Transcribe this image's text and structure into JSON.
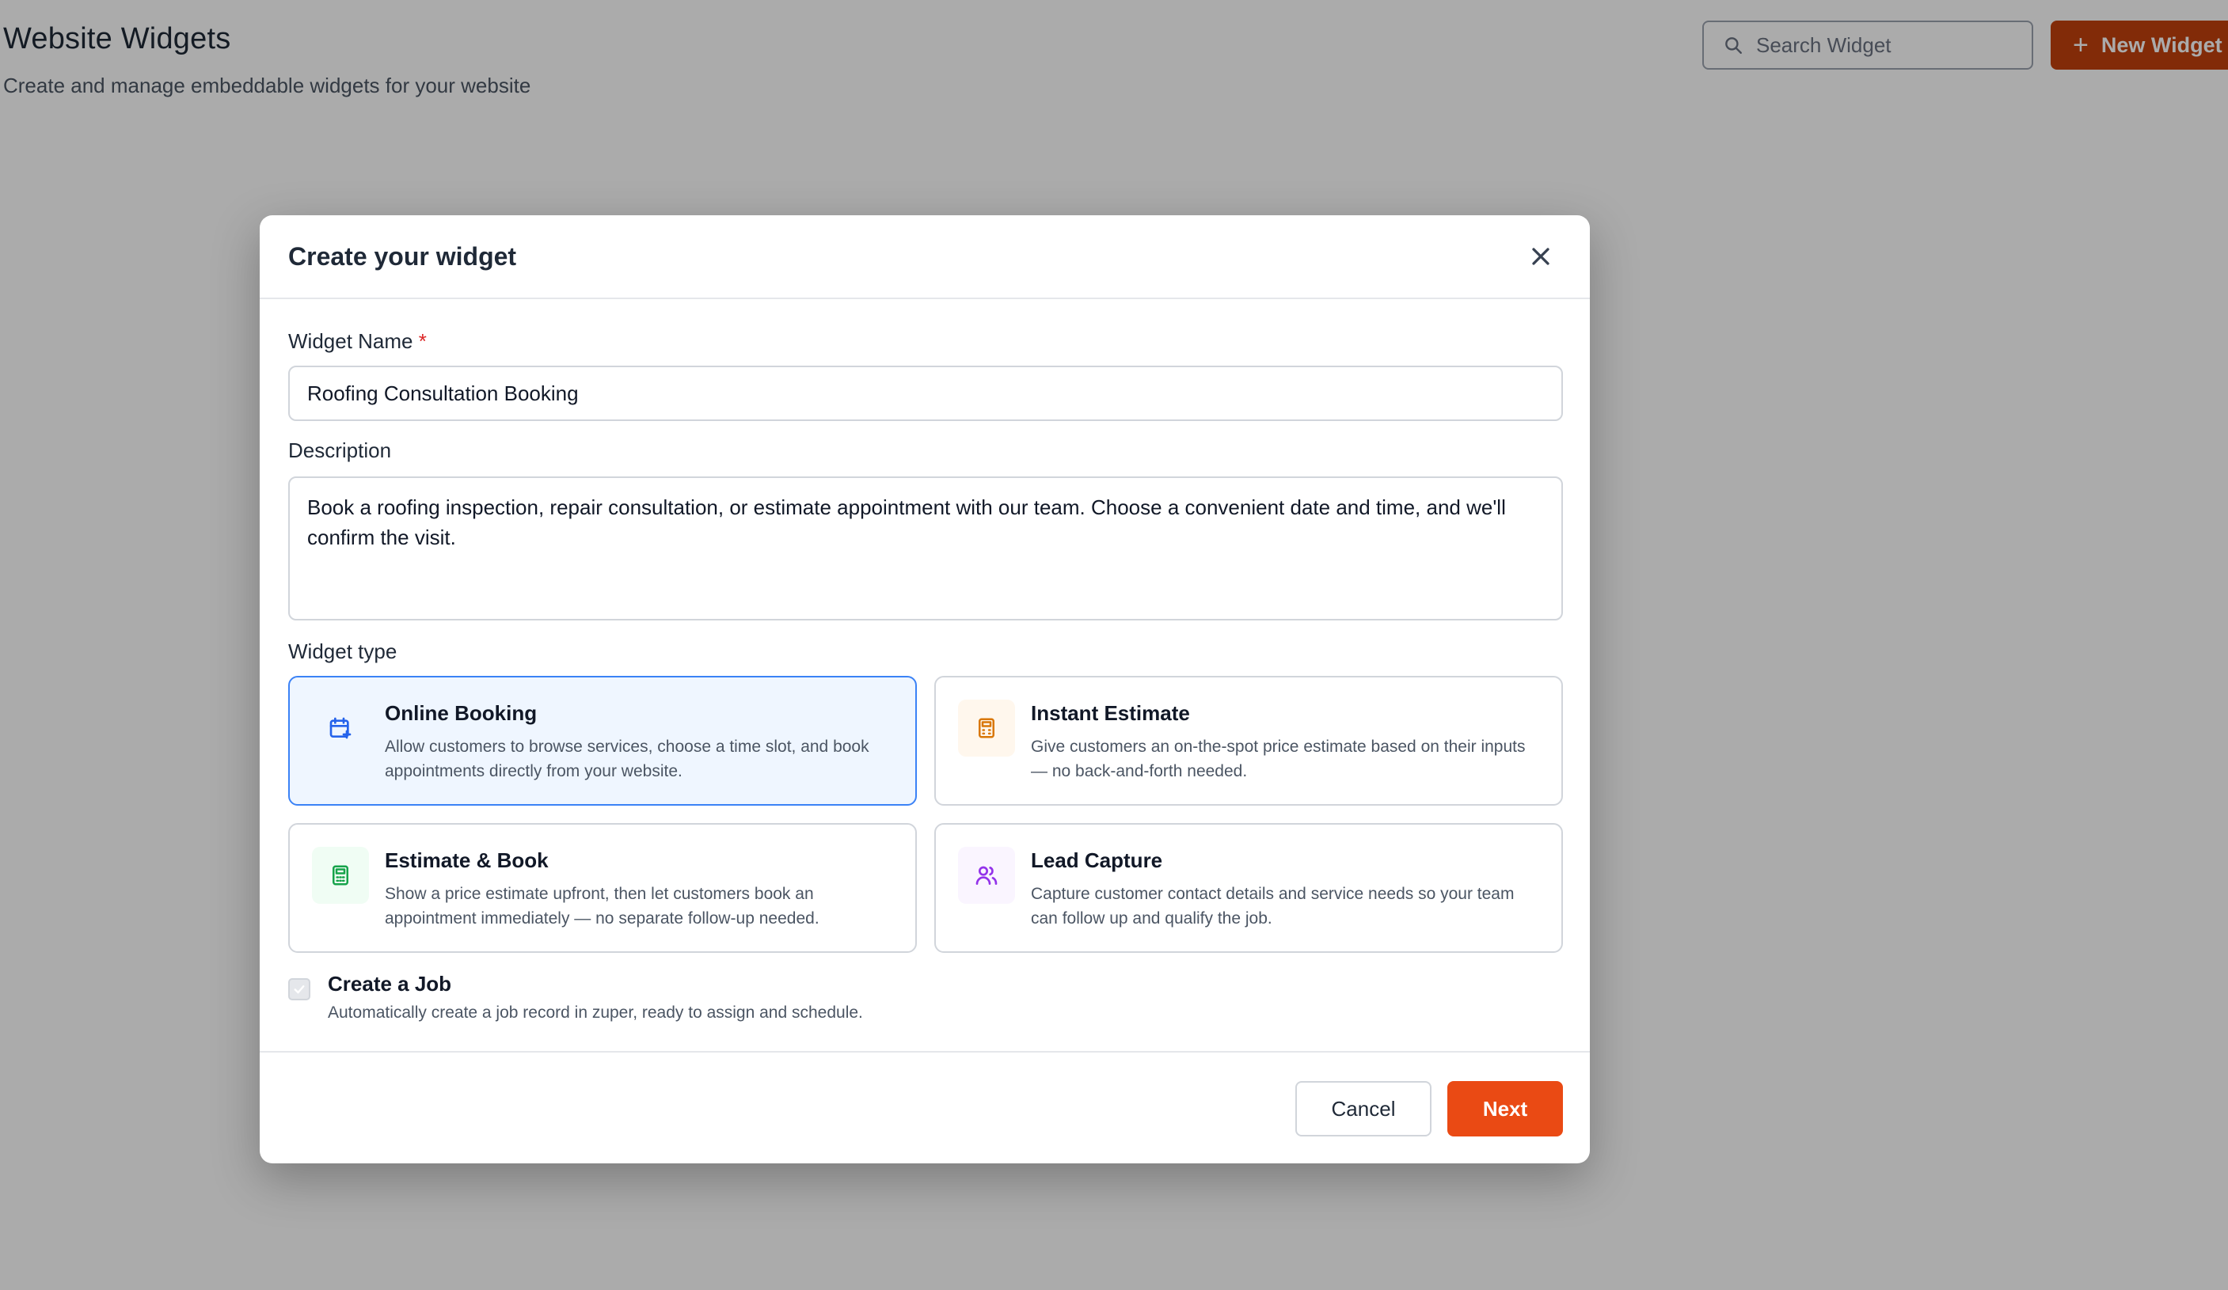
{
  "page": {
    "title": "Website Widgets",
    "subtitle": "Create and manage embeddable widgets for your website",
    "search_placeholder": "Search Widget",
    "new_widget_label": "New Widget",
    "accent_color": "#c2410c"
  },
  "modal": {
    "title": "Create your widget",
    "widget_name_label": "Widget Name",
    "required_marker": "*",
    "widget_name_value": "Roofing Consultation Booking",
    "description_label": "Description",
    "description_value": "Book a roofing inspection, repair consultation, or estimate appointment with our team. Choose a convenient date and time, and we'll confirm the visit.",
    "widget_type_label": "Widget type",
    "widget_types": [
      {
        "title": "Online Booking",
        "description": "Allow customers to browse services, choose a time slot, and book appointments directly from your website.",
        "icon": "calendar-plus-icon",
        "selected": true,
        "icon_color": "#2563eb"
      },
      {
        "title": "Instant Estimate",
        "description": "Give customers an on-the-spot price estimate based on their inputs — no back-and-forth needed.",
        "icon": "calculator-icon",
        "selected": false,
        "icon_color": "#d97706"
      },
      {
        "title": "Estimate & Book",
        "description": "Show a price estimate upfront, then let customers book an appointment immediately — no separate follow-up needed.",
        "icon": "calculator-icon",
        "selected": false,
        "icon_color": "#16a34a"
      },
      {
        "title": "Lead Capture",
        "description": "Capture customer contact details and service needs so your team can follow up and qualify the job.",
        "icon": "users-icon",
        "selected": false,
        "icon_color": "#9333ea"
      }
    ],
    "create_job": {
      "title": "Create a Job",
      "description": "Automatically create a job record in zuper, ready to assign and schedule.",
      "checked": true,
      "disabled": true
    },
    "cancel_label": "Cancel",
    "next_label": "Next"
  }
}
